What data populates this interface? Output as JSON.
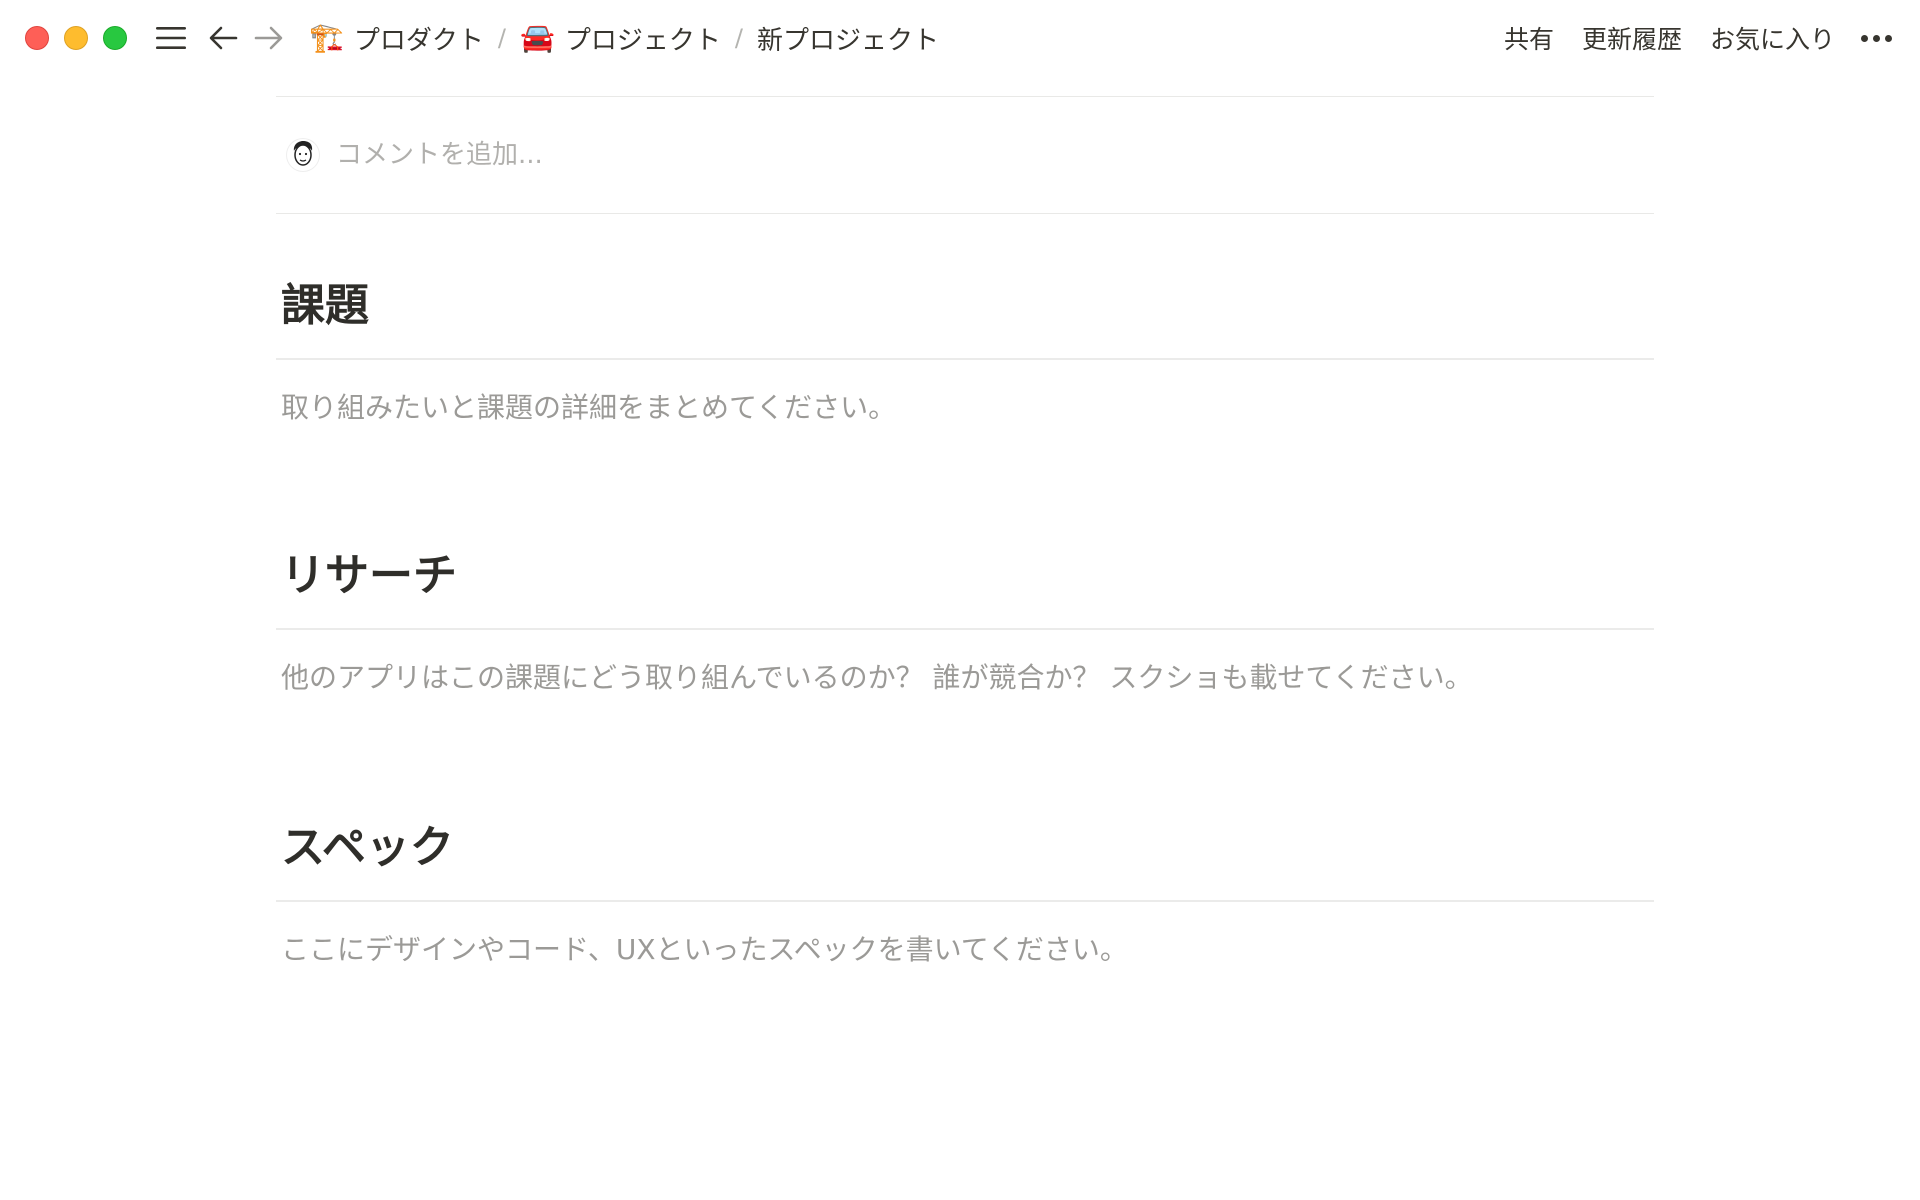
{
  "window": {
    "controls": [
      "close",
      "minimize",
      "zoom"
    ]
  },
  "nav": {
    "menu_icon": "menu-icon",
    "back_icon": "arrow-left-icon",
    "forward_icon": "arrow-right-icon"
  },
  "breadcrumb": {
    "items": [
      {
        "emoji": "🏗️",
        "label": "プロダクト"
      },
      {
        "emoji": "🚘",
        "label": "プロジェクト"
      },
      {
        "emoji": "",
        "label": "新プロジェクト"
      }
    ],
    "separator": "/"
  },
  "topbar": {
    "share_label": "共有",
    "history_label": "更新履歴",
    "favorite_label": "お気に入り"
  },
  "comment": {
    "placeholder": "コメントを追加..."
  },
  "sections": [
    {
      "heading": "課題",
      "placeholder": "取り組みたいと課題の詳細をまとめてください。"
    },
    {
      "heading": "リサーチ",
      "placeholder": "他のアプリはこの課題にどう取り組んでいるのか？ 誰が競合か？ スクショも載せてください。"
    },
    {
      "heading": "スペック",
      "placeholder": "ここにデザインやコード、UXといったスペックを書いてください。"
    }
  ]
}
